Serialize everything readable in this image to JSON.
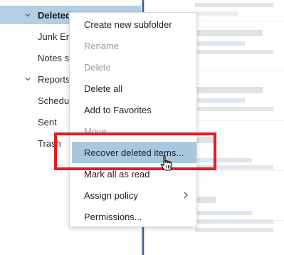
{
  "folders": [
    {
      "label": "Deleted",
      "expandable": true,
      "selected": true
    },
    {
      "label": "Junk Er",
      "expandable": false,
      "selected": false
    },
    {
      "label": "Notes s",
      "expandable": false,
      "selected": false
    },
    {
      "label": "Reports",
      "expandable": true,
      "selected": false
    },
    {
      "label": "Schedul",
      "expandable": false,
      "selected": false
    },
    {
      "label": "Sent",
      "expandable": false,
      "selected": false
    },
    {
      "label": "Trash",
      "expandable": false,
      "selected": false
    }
  ],
  "context_menu": {
    "items": [
      {
        "label": "Create new subfolder",
        "enabled": true
      },
      {
        "label": "Rename",
        "enabled": false
      },
      {
        "label": "Delete",
        "enabled": false
      },
      {
        "label": "Delete all",
        "enabled": true
      },
      {
        "label": "Add to Favorites",
        "enabled": true
      },
      {
        "label": "Move",
        "enabled": false
      },
      {
        "label": "Recover deleted items...",
        "enabled": true,
        "highlighted": true
      },
      {
        "label": "Mark all as read",
        "enabled": true
      },
      {
        "label": "Assign policy",
        "enabled": true,
        "submenu": true
      },
      {
        "label": "Permissions...",
        "enabled": true
      }
    ]
  },
  "colors": {
    "selected_folder_bg": "#b4cfe4",
    "menu_highlight_bg": "#a9c8dd",
    "annotation_border": "#e01e25",
    "divider": "#2f5f8f"
  },
  "icons": {
    "folder_expand": "chevron-down-icon",
    "submenu": "chevron-right-icon",
    "cursor": "hand-pointer-icon"
  }
}
